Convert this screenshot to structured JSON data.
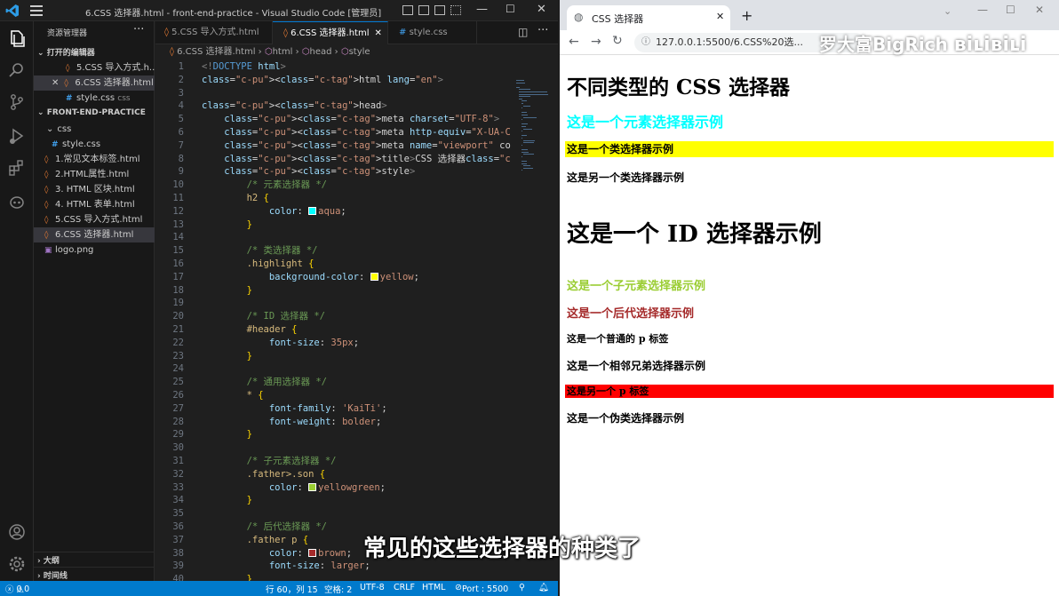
{
  "vscode": {
    "window_title": "6.CSS 选择器.html - front-end-practice - Visual Studio Code [管理员]",
    "sidebar": {
      "title": "资源管理器",
      "open_editors_label": "打开的编辑器",
      "open_editors": [
        {
          "name": "5.CSS 导入方式.h...",
          "icon": "html-file-icon"
        },
        {
          "name": "6.CSS 选择器.html",
          "icon": "html-file-icon"
        },
        {
          "name": "style.css",
          "icon": "css-file-icon",
          "hint": "css"
        }
      ],
      "project_label": "FRONT-END-PRACTICE",
      "tree": [
        {
          "name": "css",
          "type": "folder"
        },
        {
          "name": "style.css",
          "type": "css"
        },
        {
          "name": "1.常见文本标签.html",
          "type": "html"
        },
        {
          "name": "2.HTML属性.html",
          "type": "html"
        },
        {
          "name": "3. HTML 区块.html",
          "type": "html"
        },
        {
          "name": "4. HTML 表单.html",
          "type": "html"
        },
        {
          "name": "5.CSS 导入方式.html",
          "type": "html"
        },
        {
          "name": "6.CSS 选择器.html",
          "type": "html"
        },
        {
          "name": "logo.png",
          "type": "png"
        }
      ],
      "outline_label": "大纲",
      "timeline_label": "时间线"
    },
    "tabs": [
      {
        "label": "5.CSS 导入方式.html"
      },
      {
        "label": "6.CSS 选择器.html"
      },
      {
        "label": "style.css"
      }
    ],
    "breadcrumb": [
      "6.CSS 选择器.html",
      "html",
      "head",
      "style"
    ],
    "code_lines": [
      "<!DOCTYPE html>",
      "<html lang=\"en\">",
      "",
      "<head>",
      "    <meta charset=\"UTF-8\">",
      "    <meta http-equiv=\"X-UA-Compatible\" content=\"IE=edge\">",
      "    <meta name=\"viewport\" content=\"width=device-width, initi",
      "    <title>CSS 选择器</title>",
      "    <style>",
      "        /* 元素选择器 */",
      "        h2 {",
      "            color: aqua;",
      "        }",
      "",
      "        /* 类选择器 */",
      "        .highlight {",
      "            background-color: yellow;",
      "        }",
      "",
      "        /* ID 选择器 */",
      "        #header {",
      "            font-size: 35px;",
      "        }",
      "",
      "        /* 通用选择器 */",
      "        * {",
      "            font-family: 'KaiTi';",
      "            font-weight: bolder;",
      "        }",
      "",
      "        /* 子元素选择器 */",
      "        .father>.son {",
      "            color: yellowgreen;",
      "        }",
      "",
      "        /* 后代选择器 */",
      "        .father p {",
      "            color: brown;",
      "            font-size: larger;",
      "        }"
    ],
    "status": {
      "problems": "0",
      "warnings": "0",
      "cursor": "行 60，列 15",
      "spaces": "空格: 2",
      "encoding": "UTF-8",
      "eol": "CRLF",
      "language": "HTML",
      "port": "Port : 5500"
    }
  },
  "browser": {
    "tab_title": "CSS 选择器",
    "url": "127.0.0.1:5500/6.CSS%20选...",
    "page": {
      "h1": "不同类型的 CSS 选择器",
      "h2": "这是一个元素选择器示例",
      "highlight1": "这是一个类选择器示例",
      "highlight2": "这是另一个类选择器示例",
      "header": "这是一个 ID 选择器示例",
      "son": "这是一个子元素选择器示例",
      "descendant": "这是一个后代选择器示例",
      "normal_p": "这是一个普通的 p 标签",
      "sibling": "这是一个相邻兄弟选择器示例",
      "another_p": "这是另一个 p 标签",
      "pseudo": "这是一个伪类选择器示例"
    }
  },
  "overlay": {
    "subtitle": "常见的这些选择器的种类了",
    "watermark": "罗大富BigRich"
  },
  "colors": {
    "accent": "#007acc",
    "aqua": "#00ffff",
    "yellow": "#ffff00",
    "yellowgreen": "#9acd32",
    "brown": "#a52a2a",
    "red": "#ff0000"
  }
}
